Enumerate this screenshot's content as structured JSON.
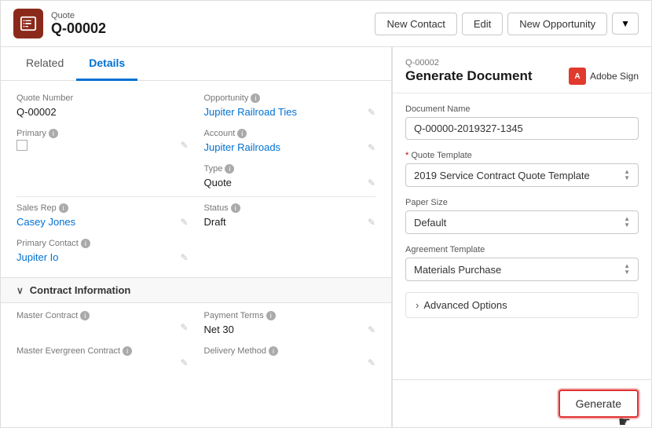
{
  "header": {
    "icon_symbol": "🛒",
    "label": "Quote",
    "title": "Q-00002",
    "btn_new_contact": "New Contact",
    "btn_edit": "Edit",
    "btn_new_opportunity": "New Opportunity",
    "btn_dropdown_symbol": "▼"
  },
  "tabs": {
    "related": "Related",
    "details": "Details"
  },
  "form": {
    "quote_number_label": "Quote Number",
    "quote_number_value": "Q-00002",
    "opportunity_label": "Opportunity",
    "opportunity_value": "Jupiter Railroad Ties",
    "primary_label": "Primary",
    "account_label": "Account",
    "account_value": "Jupiter Railroads",
    "type_label": "Type",
    "type_value": "Quote",
    "sales_rep_label": "Sales Rep",
    "sales_rep_value": "Casey Jones",
    "status_label": "Status",
    "status_value": "Draft",
    "primary_contact_label": "Primary Contact",
    "primary_contact_value": "Jupiter Io",
    "contract_section_label": "Contract Information",
    "master_contract_label": "Master Contract",
    "payment_terms_label": "Payment Terms",
    "payment_terms_value": "Net 30",
    "master_evergreen_label": "Master Evergreen Contract",
    "delivery_method_label": "Delivery Method"
  },
  "right_panel": {
    "sub_label": "Q-00002",
    "title": "Generate Document",
    "adobe_sign_label": "Adobe Sign",
    "adobe_icon_text": "A",
    "doc_name_label": "Document Name",
    "doc_name_value": "Q-00000-2019327-1345",
    "quote_template_label": "Quote Template",
    "quote_template_required": "* ",
    "quote_template_value": "2019 Service Contract Quote Template",
    "paper_size_label": "Paper Size",
    "paper_size_value": "Default",
    "agreement_template_label": "Agreement Template",
    "agreement_template_value": "Materials Purchase",
    "advanced_options_label": "> Advanced Options",
    "generate_btn_label": "Generate",
    "cursor_symbol": "☛"
  },
  "icons": {
    "info": "ⓘ",
    "chevron_down": "∨",
    "chevron_right": "›",
    "edit": "✎",
    "arrow_up": "▲",
    "arrow_down": "▼"
  }
}
